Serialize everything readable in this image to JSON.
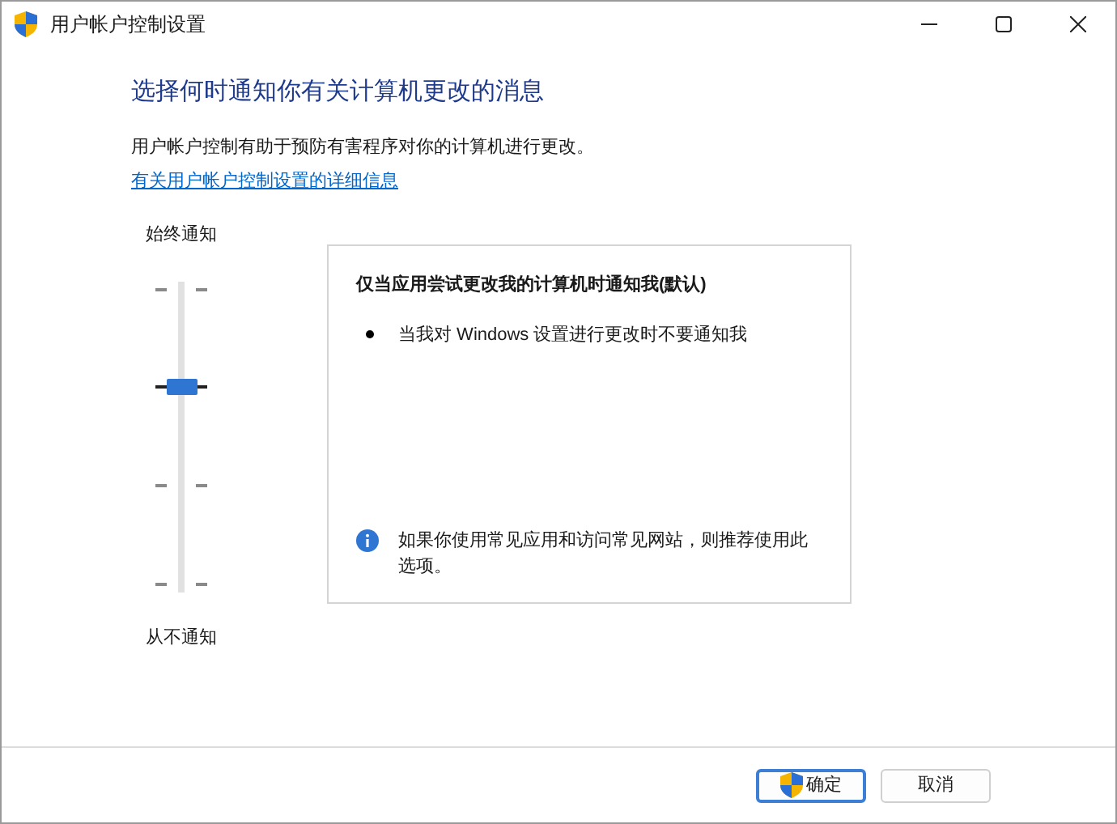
{
  "window": {
    "title": "用户帐户控制设置"
  },
  "heading": "选择何时通知你有关计算机更改的消息",
  "description": "用户帐户控制有助于预防有害程序对你的计算机进行更改。",
  "link": "有关用户帐户控制设置的详细信息",
  "slider": {
    "top_label": "始终通知",
    "bottom_label": "从不通知",
    "level": 0.67
  },
  "info_panel": {
    "title": "仅当应用尝试更改我的计算机时通知我(默认)",
    "bullets": [
      "当我对 Windows 设置进行更改时不要通知我"
    ],
    "note": "如果你使用常见应用和访问常见网站，则推荐使用此选项。"
  },
  "buttons": [
    {
      "label": "确定",
      "kind": "primary"
    },
    {
      "label": "取消",
      "kind": "secondary"
    }
  ]
}
